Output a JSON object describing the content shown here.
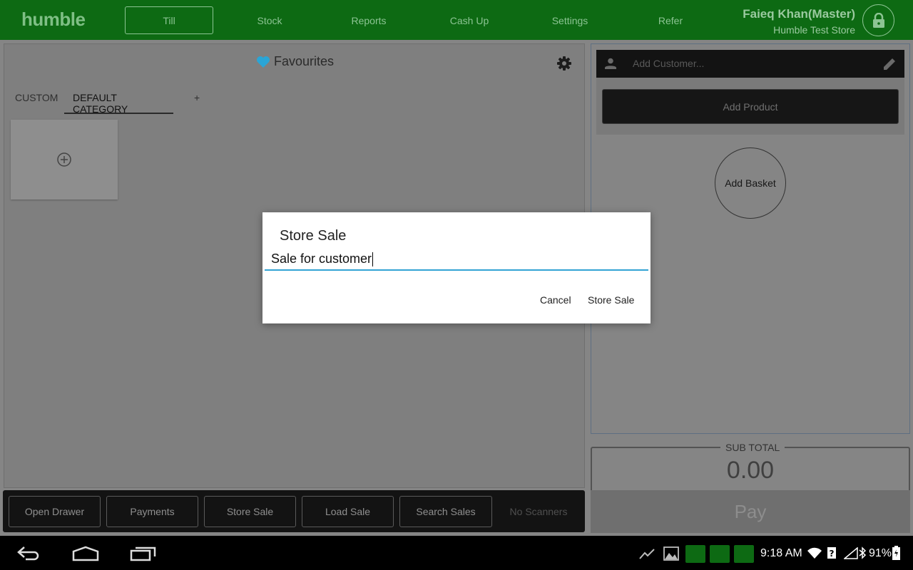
{
  "app": {
    "logo": "humble",
    "nav": [
      "Till",
      "Stock",
      "Reports",
      "Cash Up",
      "Settings",
      "Refer"
    ],
    "active_nav": "Till",
    "user_name": "Faieq Khan(Master)",
    "store_name": "Humble Test Store"
  },
  "favourites": {
    "title": "Favourites",
    "tabs": [
      "CUSTOM",
      "DEFAULT CATEGORY",
      "+"
    ],
    "active_tab": "DEFAULT CATEGORY"
  },
  "actions": [
    "Open Drawer",
    "Payments",
    "Store Sale",
    "Load Sale",
    "Search Sales",
    "No Scanners"
  ],
  "cart": {
    "customer_placeholder": "Add Customer...",
    "add_product": "Add Product",
    "add_basket": "Add Basket",
    "subtotal_label": "SUB TOTAL",
    "subtotal_value": "0.00",
    "pay": "Pay"
  },
  "dialog": {
    "title": "Store Sale",
    "input_value": "Sale for customer",
    "cancel": "Cancel",
    "confirm": "Store Sale"
  },
  "system": {
    "time": "9:18 AM",
    "battery": "91%"
  },
  "colors": {
    "brand_green": "#0d6a13",
    "accent_blue": "#33a3d4",
    "heart": "#2aa5d6"
  }
}
